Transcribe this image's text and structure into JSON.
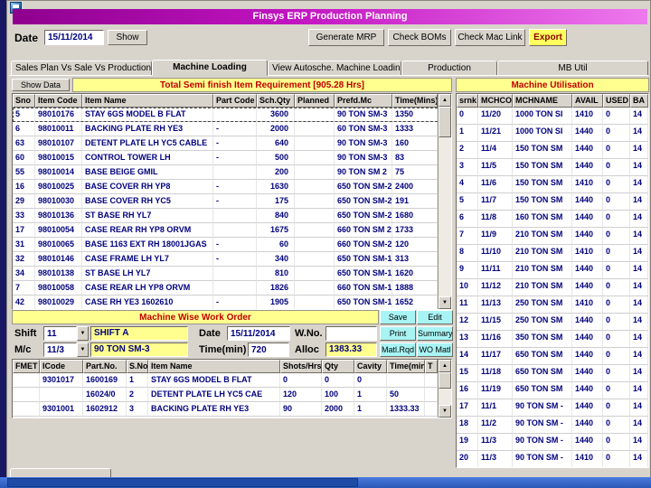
{
  "window": {
    "title": "Finsys ERP Production Planning"
  },
  "toolbar": {
    "date_label": "Date",
    "date_value": "15/11/2014",
    "show": "Show",
    "generate_mrp": "Generate MRP",
    "check_boms": "Check BOMs",
    "check_mac_link": "Check Mac Link",
    "export": "Export"
  },
  "tabs": [
    {
      "label": "Sales Plan Vs Sale Vs Production"
    },
    {
      "label": "Machine Loading"
    },
    {
      "label": "View Autosche. Machine Loading"
    },
    {
      "label": "Production"
    },
    {
      "label": "MB Util"
    }
  ],
  "semi_finish": {
    "show_data": "Show Data",
    "title": "Total Semi finish Item Requirement [905.28 Hrs]",
    "columns": [
      "Sno",
      "Item Code",
      "Item Name",
      "Part Code",
      "Sch.Qty",
      "Planned",
      "Prefd.Mc",
      "Time(Mins)"
    ],
    "focus_row": 0,
    "rows": [
      [
        "5",
        "98010176",
        "STAY 6GS MODEL B FLAT",
        "",
        "3600",
        "",
        "90 TON SM-3",
        "1350"
      ],
      [
        "6",
        "98010011",
        "BACKING PLATE RH YE3",
        "-",
        "2000",
        "",
        "60 TON SM-3",
        "1333"
      ],
      [
        "63",
        "98010107",
        "DETENT PLATE LH YC5 CABLE",
        "-",
        "640",
        "",
        "90 TON SM-3",
        "160"
      ],
      [
        "60",
        "98010015",
        "CONTROL TOWER LH",
        "-",
        "500",
        "",
        "90 TON SM-3",
        "83"
      ],
      [
        "55",
        "98010014",
        "BASE BEIGE GMIL",
        "",
        "200",
        "",
        "90 TON SM 2",
        "75"
      ],
      [
        "16",
        "98010025",
        "BASE COVER RH YP8",
        "-",
        "1630",
        "",
        "650 TON SM-2",
        "2400"
      ],
      [
        "29",
        "98010030",
        "BASE COVER RH YC5",
        "-",
        "175",
        "",
        "650 TON SM-2",
        "191"
      ],
      [
        "33",
        "98010136",
        "ST BASE RH YL7",
        "",
        "840",
        "",
        "650 TON SM-2",
        "1680"
      ],
      [
        "17",
        "98010054",
        "CASE REAR RH YP8 ORVM",
        "",
        "1675",
        "",
        "660 TON SM 2",
        "1733"
      ],
      [
        "31",
        "98010065",
        "BASE 1163 EXT RH 18001JGAS",
        "-",
        "60",
        "",
        "660 TON SM-2",
        "120"
      ],
      [
        "32",
        "98010146",
        "CASE FRAME LH YL7",
        "-",
        "340",
        "",
        "650 TON SM-1",
        "313"
      ],
      [
        "34",
        "98010138",
        "ST BASE LH YL7",
        "",
        "810",
        "",
        "650 TON SM-1",
        "1620"
      ],
      [
        "7",
        "98010058",
        "CASE REAR LH YP8 ORVM",
        "",
        "1826",
        "",
        "660 TON SM-1",
        "1888"
      ],
      [
        "42",
        "98010029",
        "CASE RH YE3 1602610",
        "-",
        "1905",
        "",
        "650 TON SM-1",
        "1652"
      ]
    ]
  },
  "machine_utilisation": {
    "title": "Machine Utilisation",
    "columns": [
      "srnk",
      "MCHCO",
      "MCHNAME",
      "AVAIL",
      "USED",
      "BA"
    ],
    "rows": [
      [
        "0",
        "11/20",
        "1000 TON SI",
        "1410",
        "0",
        "14"
      ],
      [
        "1",
        "11/21",
        "1000 TON SI",
        "1440",
        "0",
        "14"
      ],
      [
        "2",
        "11/4",
        "150 TON SM",
        "1440",
        "0",
        "14"
      ],
      [
        "3",
        "11/5",
        "150 TON SM",
        "1440",
        "0",
        "14"
      ],
      [
        "4",
        "11/6",
        "150 TON SM",
        "1410",
        "0",
        "14"
      ],
      [
        "5",
        "11/7",
        "150 TON SM",
        "1440",
        "0",
        "14"
      ],
      [
        "6",
        "11/8",
        "160 TON SM",
        "1440",
        "0",
        "14"
      ],
      [
        "7",
        "11/9",
        "210 TON SM",
        "1440",
        "0",
        "14"
      ],
      [
        "8",
        "11/10",
        "210 TON SM",
        "1410",
        "0",
        "14"
      ],
      [
        "9",
        "11/11",
        "210 TON SM",
        "1440",
        "0",
        "14"
      ],
      [
        "10",
        "11/12",
        "210 TON SM",
        "1440",
        "0",
        "14"
      ],
      [
        "11",
        "11/13",
        "250 TON SM",
        "1410",
        "0",
        "14"
      ],
      [
        "12",
        "11/15",
        "250 TON SM",
        "1440",
        "0",
        "14"
      ],
      [
        "13",
        "11/16",
        "350 TON SM",
        "1440",
        "0",
        "14"
      ],
      [
        "14",
        "11/17",
        "650 TON SM",
        "1440",
        "0",
        "14"
      ],
      [
        "15",
        "11/18",
        "650 TON SM",
        "1440",
        "0",
        "14"
      ],
      [
        "16",
        "11/19",
        "650 TON SM",
        "1440",
        "0",
        "14"
      ],
      [
        "17",
        "11/1",
        "90 TON SM -",
        "1440",
        "0",
        "14"
      ],
      [
        "18",
        "11/2",
        "90 TON SM -",
        "1440",
        "0",
        "14"
      ],
      [
        "19",
        "11/3",
        "90 TON SM -",
        "1440",
        "0",
        "14"
      ],
      [
        "20",
        "11/3",
        "90 TON SM -",
        "1410",
        "0",
        "14"
      ]
    ]
  },
  "work_order": {
    "title": "Machine Wise Work Order",
    "save": "Save",
    "edit": "Edit",
    "print": "Print",
    "summary": "Summary",
    "matl_rqd": "Matl.Rqd",
    "wo_matl": "WO Matl",
    "shift_label": "Shift",
    "shift_value": "11",
    "shift_name": "SHIFT A",
    "date_label": "Date",
    "date_value": "15/11/2014",
    "wno_label": "W.No.",
    "wno_value": "",
    "mc_label": "M/c",
    "mc_value": "11/3",
    "mc_name": "90 TON SM-3",
    "time_label": "Time(min)",
    "time_value": "720",
    "alloc_label": "Alloc",
    "alloc_value": "1383.33"
  },
  "work_order_grid": {
    "columns": [
      "FMET",
      "ICode",
      "Part.No.",
      "S.No",
      "Item Name",
      "Shots/Hrs",
      "Qty",
      "Cavity",
      "Time(min)",
      "T"
    ],
    "rows": [
      [
        "",
        "9301017",
        "1600169",
        "1",
        "STAY 6GS MODEL B FLAT",
        "0",
        "0",
        "0",
        "",
        ""
      ],
      [
        "",
        "",
        "16024/0",
        "2",
        "DETENT PLATE LH YC5 CAE",
        "120",
        "100",
        "1",
        "50",
        ""
      ],
      [
        "",
        "9301001",
        "1602912",
        "3",
        "BACKING PLATE RH YE3",
        "90",
        "2000",
        "1",
        "1333.33",
        ""
      ]
    ]
  }
}
